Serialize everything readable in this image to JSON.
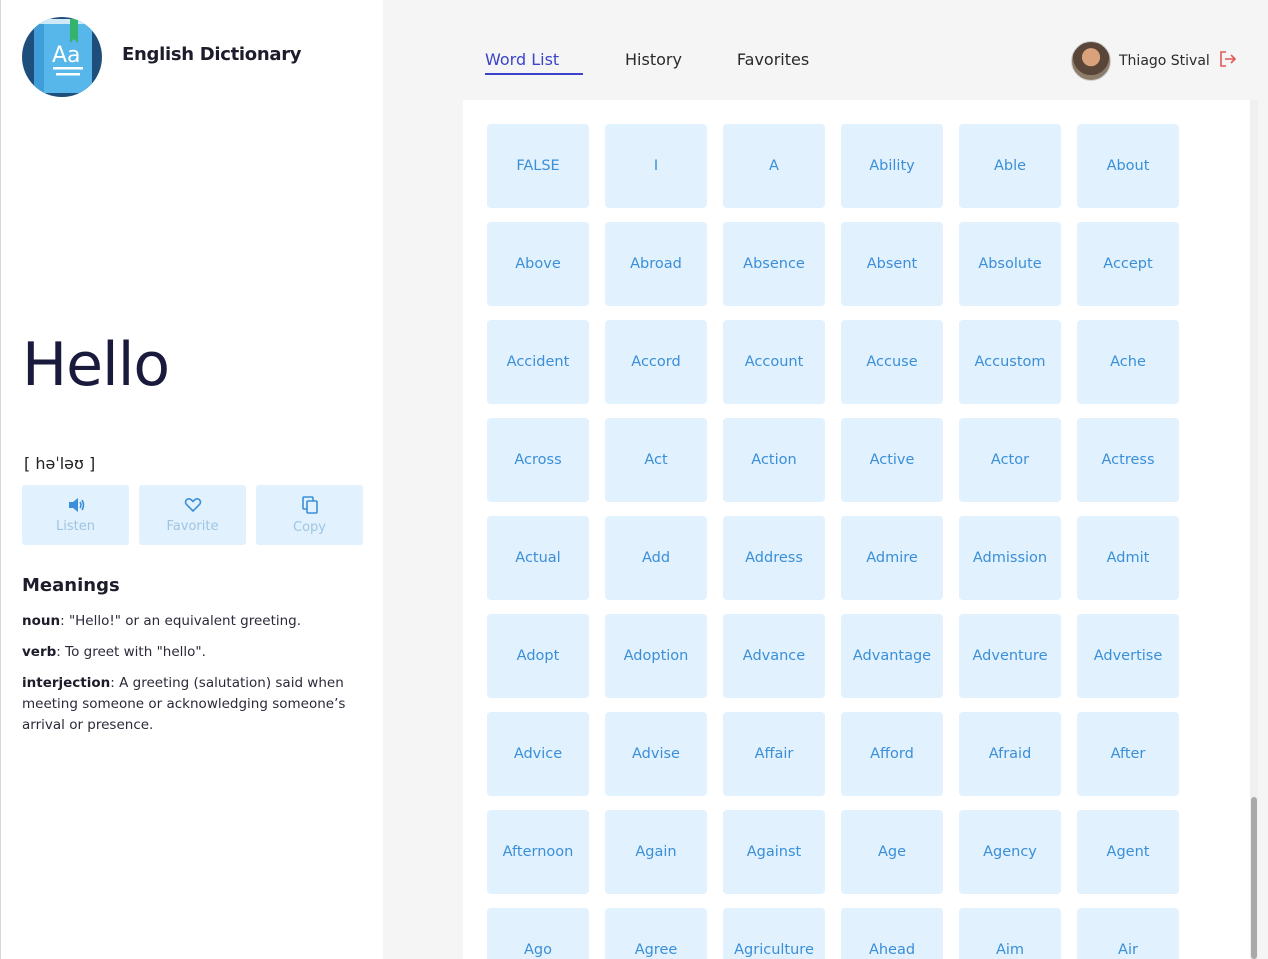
{
  "app": {
    "title": "English Dictionary"
  },
  "nav": {
    "tabs": [
      {
        "label": "Word List"
      },
      {
        "label": "History"
      },
      {
        "label": "Favorites"
      }
    ]
  },
  "user": {
    "name": "Thiago Stival"
  },
  "entry": {
    "word": "Hello",
    "phonetic": "[ həˈləʊ ]",
    "actions": {
      "listen": "Listen",
      "favorite": "Favorite",
      "copy": "Copy"
    },
    "meanings_title": "Meanings",
    "meanings": [
      {
        "pos": "noun",
        "text": ": \"Hello!\" or an equivalent greeting."
      },
      {
        "pos": "verb",
        "text": ": To greet with \"hello\"."
      },
      {
        "pos": "interjection",
        "text": ": A greeting (salutation) said when meeting someone or acknowledging someone’s arrival or presence."
      }
    ]
  },
  "words": [
    "FALSE",
    "I",
    "A",
    "Ability",
    "Able",
    "About",
    "Above",
    "Abroad",
    "Absence",
    "Absent",
    "Absolute",
    "Accept",
    "Accident",
    "Accord",
    "Account",
    "Accuse",
    "Accustom",
    "Ache",
    "Across",
    "Act",
    "Action",
    "Active",
    "Actor",
    "Actress",
    "Actual",
    "Add",
    "Address",
    "Admire",
    "Admission",
    "Admit",
    "Adopt",
    "Adoption",
    "Advance",
    "Advantage",
    "Adventure",
    "Advertise",
    "Advice",
    "Advise",
    "Affair",
    "Afford",
    "Afraid",
    "After",
    "Afternoon",
    "Again",
    "Against",
    "Age",
    "Agency",
    "Agent",
    "Ago",
    "Agree",
    "Agriculture",
    "Ahead",
    "Aim",
    "Air"
  ],
  "colors": {
    "accent": "#3b44c8",
    "tile_bg": "#e1f1fd",
    "tile_text": "#3b8fd8",
    "logout": "#e05a5a"
  },
  "icons": {
    "logo": "dictionary-book-icon",
    "listen": "speaker-icon",
    "favorite": "heart-icon",
    "copy": "copy-icon",
    "logout": "logout-icon"
  }
}
